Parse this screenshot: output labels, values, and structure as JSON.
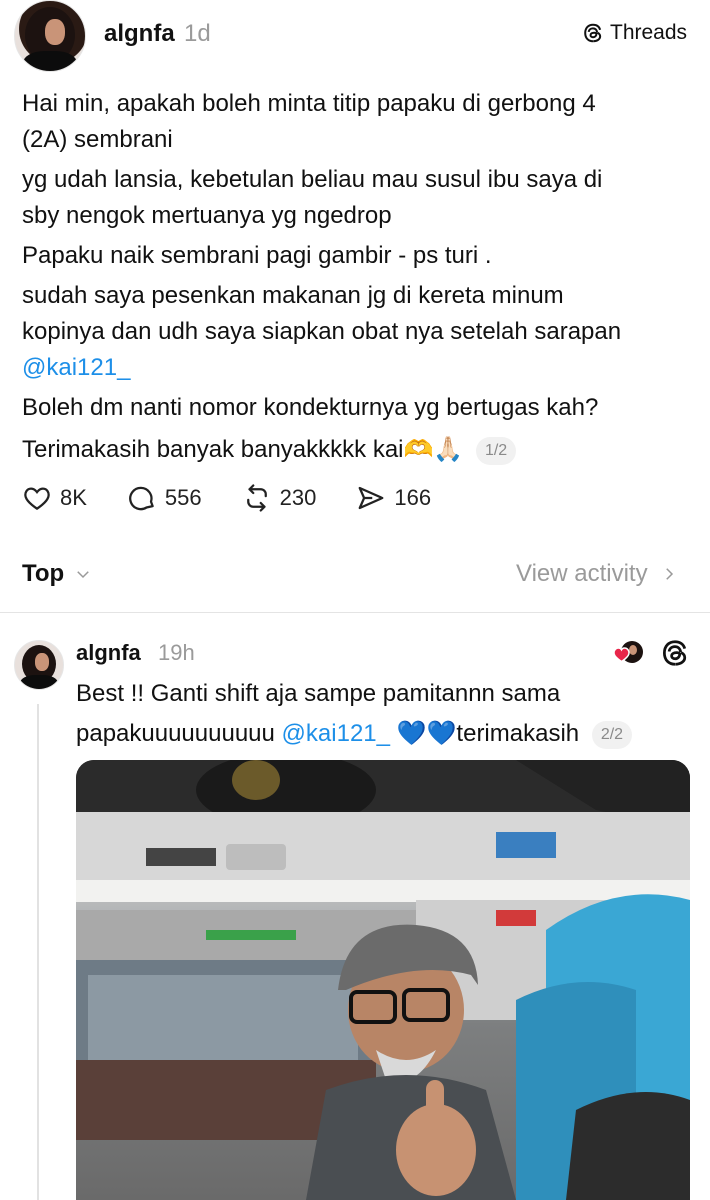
{
  "post": {
    "username": "algnfa",
    "time": "1d",
    "badge_label": "Threads",
    "lines": [
      "Hai min, apakah boleh minta titip papaku di gerbong 4",
      "(2A) sembrani",
      "yg udah lansia, kebetulan beliau mau susul ibu saya di",
      "sby nengok mertuanya yg ngedrop",
      "Papaku naik sembrani pagi gambir - ps turi .",
      "sudah saya pesenkan makanan jg di kereta minum",
      "kopinya dan udh saya siapkan obat nya setelah sarapan",
      "@kai121_",
      "Boleh dm nanti nomor kondekturnya yg bertugas kah?",
      "Terimakasih banyak banyakkkkk kai🫶🙏🏻"
    ],
    "page_indicator": "1/2",
    "stats": {
      "likes": "8K",
      "comments": "556",
      "reposts": "230",
      "shares": "166"
    }
  },
  "sort": {
    "label": "Top",
    "view_activity": "View activity"
  },
  "reply": {
    "username": "algnfa",
    "time": "19h",
    "line1": "Best !! Ganti shift aja sampe pamitannn sama",
    "line2_text": "papakuuuuuuuuuu",
    "mention": "@kai121_",
    "emoji": "💙💙",
    "line2_end": "terimakasih",
    "page_indicator": "2/2"
  },
  "colors": {
    "mention": "#1d8fe8",
    "muted": "#9a9a9a",
    "like_heart": "#e8264a"
  },
  "icons": [
    "heart-icon",
    "comment-icon",
    "repost-icon",
    "share-icon",
    "chevron-down-icon",
    "chevron-right-icon",
    "threads-logo-icon"
  ]
}
